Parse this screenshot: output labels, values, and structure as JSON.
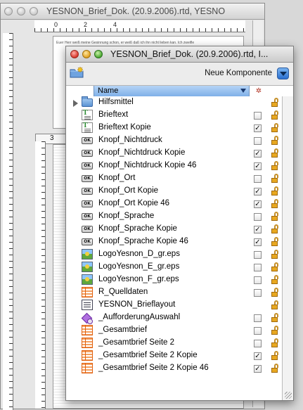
{
  "background_window": {
    "title": "YESNON_Brief_Dok. (20.9.2006).rtd, YESNO",
    "ruler_labels": [
      "0",
      "2",
      "4"
    ],
    "page_number": "3",
    "snippet_line": "Euer Herr weiß meine Gesinnung schon, er weiß daß ich ihn nicht lieben kan. Ich zweifle"
  },
  "palette": {
    "title": "YESNON_Brief_Dok. (20.9.2006).rtd, I...",
    "new_component_label": "Neue Komponente",
    "column_name": "Name",
    "items": [
      {
        "name": "Hilfsmittel",
        "icon": "folder-icon",
        "type": "folder",
        "checked": null
      },
      {
        "name": "Brieftext",
        "icon": "text-icon",
        "type": "text",
        "checked": false
      },
      {
        "name": "Brieftext Kopie",
        "icon": "text-icon",
        "type": "text",
        "checked": true
      },
      {
        "name": "Knopf_Nichtdruck",
        "icon": "button-icon",
        "type": "button",
        "checked": false
      },
      {
        "name": "Knopf_Nichtdruck Kopie",
        "icon": "button-icon",
        "type": "button",
        "checked": true
      },
      {
        "name": "Knopf_Nichtdruck Kopie 46",
        "icon": "button-icon",
        "type": "button",
        "checked": true
      },
      {
        "name": "Knopf_Ort",
        "icon": "button-icon",
        "type": "button",
        "checked": false
      },
      {
        "name": "Knopf_Ort Kopie",
        "icon": "button-icon",
        "type": "button",
        "checked": true
      },
      {
        "name": "Knopf_Ort Kopie 46",
        "icon": "button-icon",
        "type": "button",
        "checked": true
      },
      {
        "name": "Knopf_Sprache",
        "icon": "button-icon",
        "type": "button",
        "checked": false
      },
      {
        "name": "Knopf_Sprache Kopie",
        "icon": "button-icon",
        "type": "button",
        "checked": true
      },
      {
        "name": "Knopf_Sprache Kopie 46",
        "icon": "button-icon",
        "type": "button",
        "checked": true
      },
      {
        "name": "LogoYesnon_D_gr.eps",
        "icon": "image-icon",
        "type": "image",
        "checked": false
      },
      {
        "name": "LogoYesnon_E_gr.eps",
        "icon": "image-icon",
        "type": "image",
        "checked": false
      },
      {
        "name": "LogoYesnon_F_gr.eps",
        "icon": "image-icon",
        "type": "image",
        "checked": false
      },
      {
        "name": "R_Quelldaten",
        "icon": "table-icon",
        "type": "table",
        "checked": false
      },
      {
        "name": "YESNON_Brieflayout",
        "icon": "layout-icon",
        "type": "layout",
        "checked": null
      },
      {
        "name": "_AufforderungAuswahl",
        "icon": "action-icon",
        "type": "action",
        "checked": false
      },
      {
        "name": "_Gesamtbrief",
        "icon": "table-icon",
        "type": "table",
        "checked": false
      },
      {
        "name": "_Gesamtbrief Seite 2",
        "icon": "table-icon",
        "type": "table",
        "checked": false
      },
      {
        "name": "_Gesamtbrief Seite 2 Kopie",
        "icon": "table-icon",
        "type": "table",
        "checked": true
      },
      {
        "name": "_Gesamtbrief Seite 2 Kopie 46",
        "icon": "table-icon",
        "type": "table",
        "checked": true
      }
    ]
  },
  "colors": {
    "selected_header": "#7fb0e8",
    "close_button": "#d8362a",
    "minimize_button": "#e0a020",
    "zoom_button": "#4aa830",
    "lock": "#e8a820"
  }
}
